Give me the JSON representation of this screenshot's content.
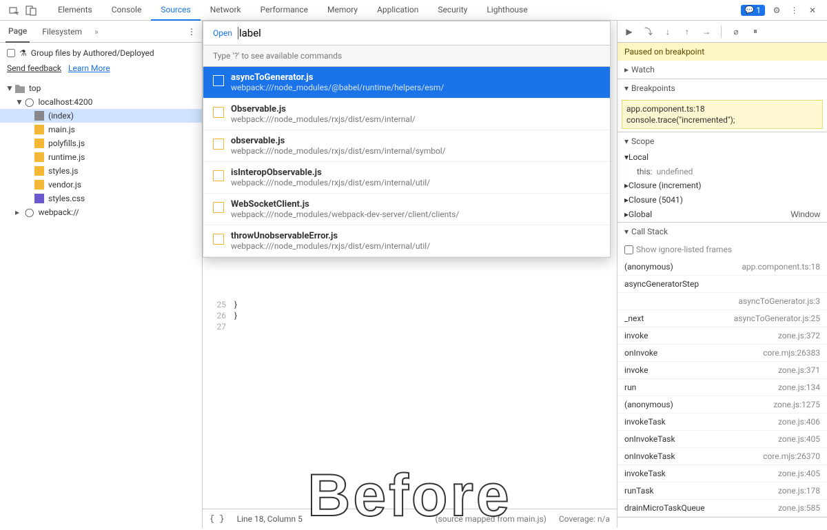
{
  "topbar": {
    "tabs": [
      "Elements",
      "Console",
      "Sources",
      "Network",
      "Performance",
      "Memory",
      "Application",
      "Security",
      "Lighthouse"
    ],
    "active_tab": "Sources",
    "msg_count": "1"
  },
  "left": {
    "subtabs": {
      "page": "Page",
      "filesystem": "Filesystem"
    },
    "group_label": "Group files by Authored/Deployed",
    "feedback": "Send feedback",
    "learn": "Learn More",
    "tree": {
      "top": "top",
      "host": "localhost:4200",
      "files": [
        "(index)",
        "main.js",
        "polyfills.js",
        "runtime.js",
        "styles.js",
        "vendor.js",
        "styles.css"
      ],
      "webpack": "webpack://"
    }
  },
  "open": {
    "label": "Open",
    "value": "label",
    "hint": "Type '?' to see available commands",
    "items": [
      {
        "fn": "asyncToGenerator.js",
        "path": "webpack:///node_modules/@babel/runtime/helpers/esm/"
      },
      {
        "fn": "Observable.js",
        "path": "webpack:///node_modules/rxjs/dist/esm/internal/"
      },
      {
        "fn": "observable.js",
        "path": "webpack:///node_modules/rxjs/dist/esm/internal/symbol/"
      },
      {
        "fn": "isInteropObservable.js",
        "path": "webpack:///node_modules/rxjs/dist/esm/internal/util/"
      },
      {
        "fn": "WebSocketClient.js",
        "path": "webpack:///node_modules/webpack-dev-server/client/clients/"
      },
      {
        "fn": "throwUnobservableError.js",
        "path": "webpack:///node_modules/rxjs/dist/esm/internal/util/"
      }
    ]
  },
  "code": {
    "lines": [
      "25",
      "26",
      "27"
    ],
    "text": [
      "  }",
      "}",
      ""
    ]
  },
  "status": {
    "line_col": "Line 18, Column 5",
    "mapped": "(source mapped from main.js)",
    "coverage": "Coverage: n/a"
  },
  "right": {
    "paused": "Paused on breakpoint",
    "watch": "Watch",
    "breakpoints": "Breakpoints",
    "bp_file": "app.component.ts:18",
    "bp_code": "console.trace(\"incremented\");",
    "scope_h": "Scope",
    "scope": {
      "local": "Local",
      "this": "this:",
      "this_v": "undefined",
      "cl1": "Closure (increment)",
      "cl2": "Closure (5041)",
      "global": "Global",
      "global_v": "Window"
    },
    "callstack_h": "Call Stack",
    "ignore": "Show ignore-listed frames",
    "stack": [
      {
        "fn": "(anonymous)",
        "loc": "app.component.ts:18"
      },
      {
        "fn": "asyncGeneratorStep",
        "loc": ""
      },
      {
        "fn": "",
        "loc": "asyncToGenerator.js:3"
      },
      {
        "fn": "_next",
        "loc": "asyncToGenerator.js:25"
      },
      {
        "fn": "invoke",
        "loc": "zone.js:372"
      },
      {
        "fn": "onInvoke",
        "loc": "core.mjs:26383"
      },
      {
        "fn": "invoke",
        "loc": "zone.js:371"
      },
      {
        "fn": "run",
        "loc": "zone.js:134"
      },
      {
        "fn": "(anonymous)",
        "loc": "zone.js:1275"
      },
      {
        "fn": "invokeTask",
        "loc": "zone.js:406"
      },
      {
        "fn": "onInvokeTask",
        "loc": "zone.js:405"
      },
      {
        "fn": "onInvokeTask",
        "loc": "core.mjs:26370"
      },
      {
        "fn": "invokeTask",
        "loc": "zone.js:405"
      },
      {
        "fn": "runTask",
        "loc": "zone.js:178"
      },
      {
        "fn": "drainMicroTaskQueue",
        "loc": "zone.js:585"
      }
    ]
  },
  "watermark": "Before"
}
